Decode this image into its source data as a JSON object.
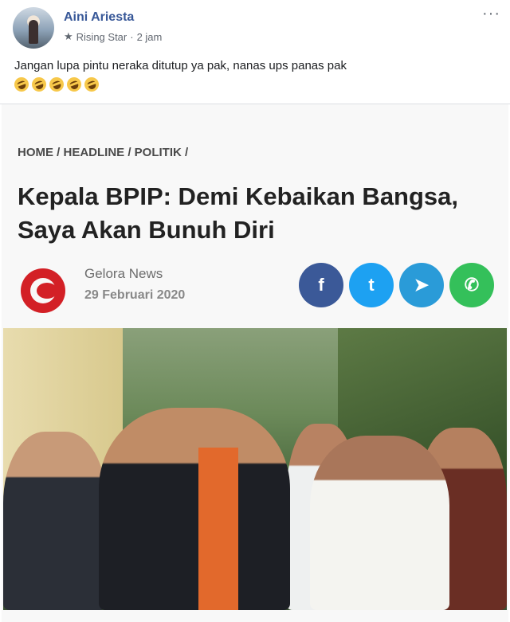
{
  "post": {
    "author": "Aini Ariesta",
    "badge": "Rising Star",
    "time": "2 jam",
    "text": "Jangan lupa pintu neraka ditutup ya pak, nanas ups panas pak",
    "more_label": "···"
  },
  "article": {
    "breadcrumb": "HOME / HEADLINE / POLITIK /",
    "headline": "Kepala BPIP: Demi Kebaikan Bangsa, Saya  Akan Bunuh Diri",
    "source": "Gelora News",
    "date": "29 Februari 2020",
    "share": {
      "facebook": "f",
      "twitter": "t",
      "telegram": "➤",
      "whatsapp": "✆"
    }
  },
  "colors": {
    "author_link": "#385898",
    "facebook": "#3b5998",
    "twitter": "#1da1f2",
    "telegram": "#2a9bd8",
    "whatsapp": "#34c05a",
    "logo_red": "#d32026"
  }
}
